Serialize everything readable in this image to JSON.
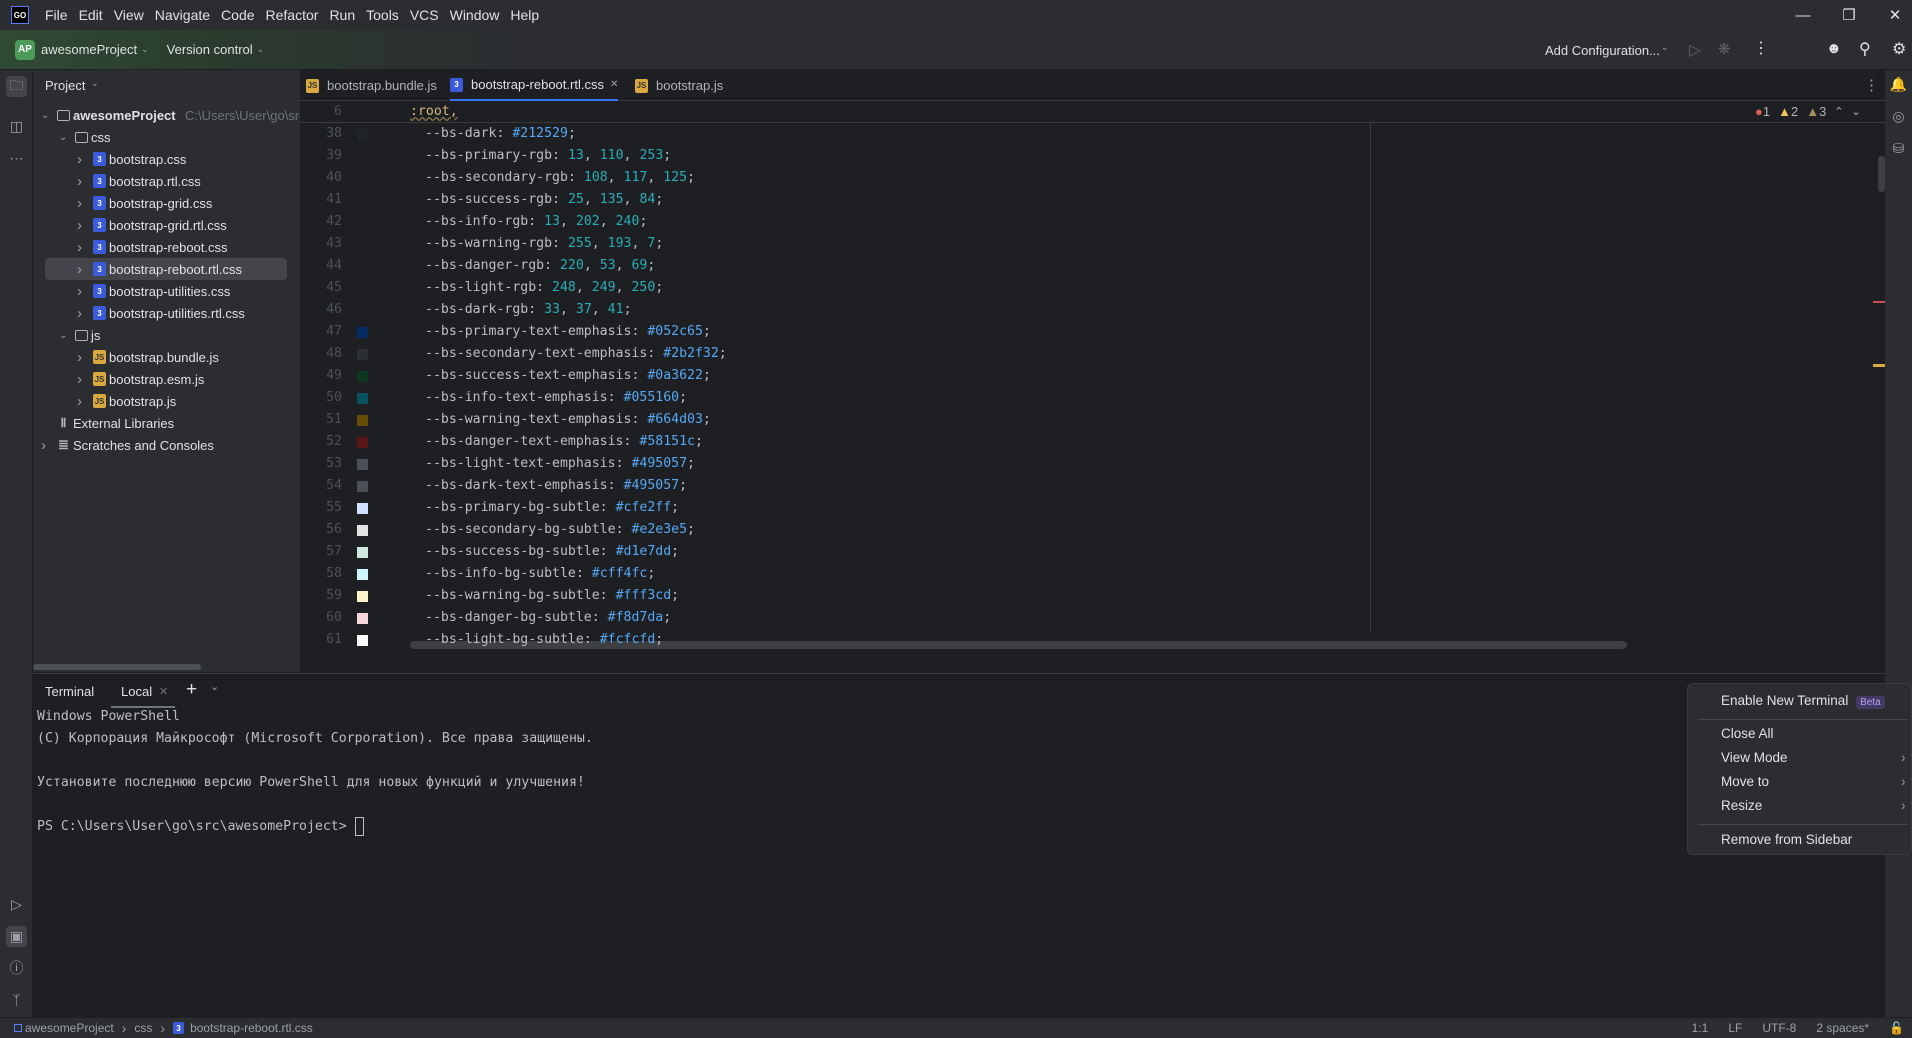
{
  "menubar": {
    "logo": "GO",
    "items": [
      "File",
      "Edit",
      "View",
      "Navigate",
      "Code",
      "Refactor",
      "Run",
      "Tools",
      "VCS",
      "Window",
      "Help"
    ]
  },
  "toolbar": {
    "project_badge": "AP",
    "project": "awesomeProject",
    "vcs": "Version control",
    "run_config": "Add Configuration..."
  },
  "project_panel": {
    "title": "Project",
    "tree": [
      {
        "label": "awesomeProject",
        "hint": "C:\\Users\\User\\go\\src\\awesomeProject",
        "depth": 0,
        "icon": "folder",
        "open": true,
        "bold": true
      },
      {
        "label": "css",
        "depth": 1,
        "icon": "folder",
        "open": true
      },
      {
        "label": "bootstrap.css",
        "depth": 2,
        "icon": "css"
      },
      {
        "label": "bootstrap.rtl.css",
        "depth": 2,
        "icon": "css"
      },
      {
        "label": "bootstrap-grid.css",
        "depth": 2,
        "icon": "css"
      },
      {
        "label": "bootstrap-grid.rtl.css",
        "depth": 2,
        "icon": "css"
      },
      {
        "label": "bootstrap-reboot.css",
        "depth": 2,
        "icon": "css"
      },
      {
        "label": "bootstrap-reboot.rtl.css",
        "depth": 2,
        "icon": "css",
        "selected": true
      },
      {
        "label": "bootstrap-utilities.css",
        "depth": 2,
        "icon": "css"
      },
      {
        "label": "bootstrap-utilities.rtl.css",
        "depth": 2,
        "icon": "css"
      },
      {
        "label": "js",
        "depth": 1,
        "icon": "folder",
        "open": true
      },
      {
        "label": "bootstrap.bundle.js",
        "depth": 2,
        "icon": "js"
      },
      {
        "label": "bootstrap.esm.js",
        "depth": 2,
        "icon": "js"
      },
      {
        "label": "bootstrap.js",
        "depth": 2,
        "icon": "js"
      },
      {
        "label": "External Libraries",
        "depth": 0,
        "icon": "library",
        "nochev": true
      },
      {
        "label": "Scratches and Consoles",
        "depth": 0,
        "icon": "scratches"
      }
    ]
  },
  "tabs": [
    {
      "label": "bootstrap.bundle.js",
      "icon": "js"
    },
    {
      "label": "bootstrap-reboot.rtl.css",
      "icon": "css",
      "active": true
    },
    {
      "label": "bootstrap.js",
      "icon": "js"
    }
  ],
  "inspections": {
    "errors": "1",
    "warnings": "2",
    "weak_warnings": "3"
  },
  "editor": {
    "sticky_line_no": "6",
    "sticky_text": ":root,",
    "lines": [
      {
        "n": "38",
        "prop": "--bs-dark",
        "value": "#212529",
        "type": "hex",
        "swatch": "#212529"
      },
      {
        "n": "39",
        "prop": "--bs-primary-rgb",
        "value": [
          "13",
          "110",
          "253"
        ],
        "type": "num"
      },
      {
        "n": "40",
        "prop": "--bs-secondary-rgb",
        "value": [
          "108",
          "117",
          "125"
        ],
        "type": "num"
      },
      {
        "n": "41",
        "prop": "--bs-success-rgb",
        "value": [
          "25",
          "135",
          "84"
        ],
        "type": "num"
      },
      {
        "n": "42",
        "prop": "--bs-info-rgb",
        "value": [
          "13",
          "202",
          "240"
        ],
        "type": "num"
      },
      {
        "n": "43",
        "prop": "--bs-warning-rgb",
        "value": [
          "255",
          "193",
          "7"
        ],
        "type": "num"
      },
      {
        "n": "44",
        "prop": "--bs-danger-rgb",
        "value": [
          "220",
          "53",
          "69"
        ],
        "type": "num"
      },
      {
        "n": "45",
        "prop": "--bs-light-rgb",
        "value": [
          "248",
          "249",
          "250"
        ],
        "type": "num"
      },
      {
        "n": "46",
        "prop": "--bs-dark-rgb",
        "value": [
          "33",
          "37",
          "41"
        ],
        "type": "num"
      },
      {
        "n": "47",
        "prop": "--bs-primary-text-emphasis",
        "value": "#052c65",
        "type": "hex",
        "swatch": "#052c65"
      },
      {
        "n": "48",
        "prop": "--bs-secondary-text-emphasis",
        "value": "#2b2f32",
        "type": "hex",
        "swatch": "#2b2f32"
      },
      {
        "n": "49",
        "prop": "--bs-success-text-emphasis",
        "value": "#0a3622",
        "type": "hex",
        "swatch": "#0a3622"
      },
      {
        "n": "50",
        "prop": "--bs-info-text-emphasis",
        "value": "#055160",
        "type": "hex",
        "swatch": "#055160"
      },
      {
        "n": "51",
        "prop": "--bs-warning-text-emphasis",
        "value": "#664d03",
        "type": "hex",
        "swatch": "#664d03"
      },
      {
        "n": "52",
        "prop": "--bs-danger-text-emphasis",
        "value": "#58151c",
        "type": "hex",
        "swatch": "#58151c"
      },
      {
        "n": "53",
        "prop": "--bs-light-text-emphasis",
        "value": "#495057",
        "type": "hex",
        "swatch": "#495057"
      },
      {
        "n": "54",
        "prop": "--bs-dark-text-emphasis",
        "value": "#495057",
        "type": "hex",
        "swatch": "#495057"
      },
      {
        "n": "55",
        "prop": "--bs-primary-bg-subtle",
        "value": "#cfe2ff",
        "type": "hex",
        "swatch": "#cfe2ff"
      },
      {
        "n": "56",
        "prop": "--bs-secondary-bg-subtle",
        "value": "#e2e3e5",
        "type": "hex",
        "swatch": "#e2e3e5"
      },
      {
        "n": "57",
        "prop": "--bs-success-bg-subtle",
        "value": "#d1e7dd",
        "type": "hex",
        "swatch": "#d1e7dd"
      },
      {
        "n": "58",
        "prop": "--bs-info-bg-subtle",
        "value": "#cff4fc",
        "type": "hex",
        "swatch": "#cff4fc"
      },
      {
        "n": "59",
        "prop": "--bs-warning-bg-subtle",
        "value": "#fff3cd",
        "type": "hex",
        "swatch": "#fff3cd"
      },
      {
        "n": "60",
        "prop": "--bs-danger-bg-subtle",
        "value": "#f8d7da",
        "type": "hex",
        "swatch": "#f8d7da"
      },
      {
        "n": "61",
        "prop": "--bs-light-bg-subtle",
        "value": "#fcfcfd",
        "type": "hex",
        "swatch": "#fcfcfd"
      }
    ]
  },
  "terminal": {
    "title": "Terminal",
    "tab": "Local",
    "lines": [
      "Windows PowerShell",
      "(C) Корпорация Майкрософт (Microsoft Corporation). Все права защищены.",
      "",
      "Установите последнюю версию PowerShell для новых функций и улучшения! "
    ],
    "link": "https://aka.ms/PSWindows",
    "prompt": "PS C:\\Users\\User\\go\\src\\awesomeProject> "
  },
  "context_menu": {
    "enable": "Enable New Terminal",
    "beta": "Beta",
    "close_all": "Close All",
    "view_mode": "View Mode",
    "move_to": "Move to",
    "resize": "Resize",
    "remove": "Remove from Sidebar"
  },
  "statusbar": {
    "crumbs": [
      "awesomeProject",
      "css",
      "bootstrap-reboot.rtl.css"
    ],
    "position": "1:1",
    "line_sep": "LF",
    "encoding": "UTF-8",
    "indent": "2 spaces*"
  }
}
